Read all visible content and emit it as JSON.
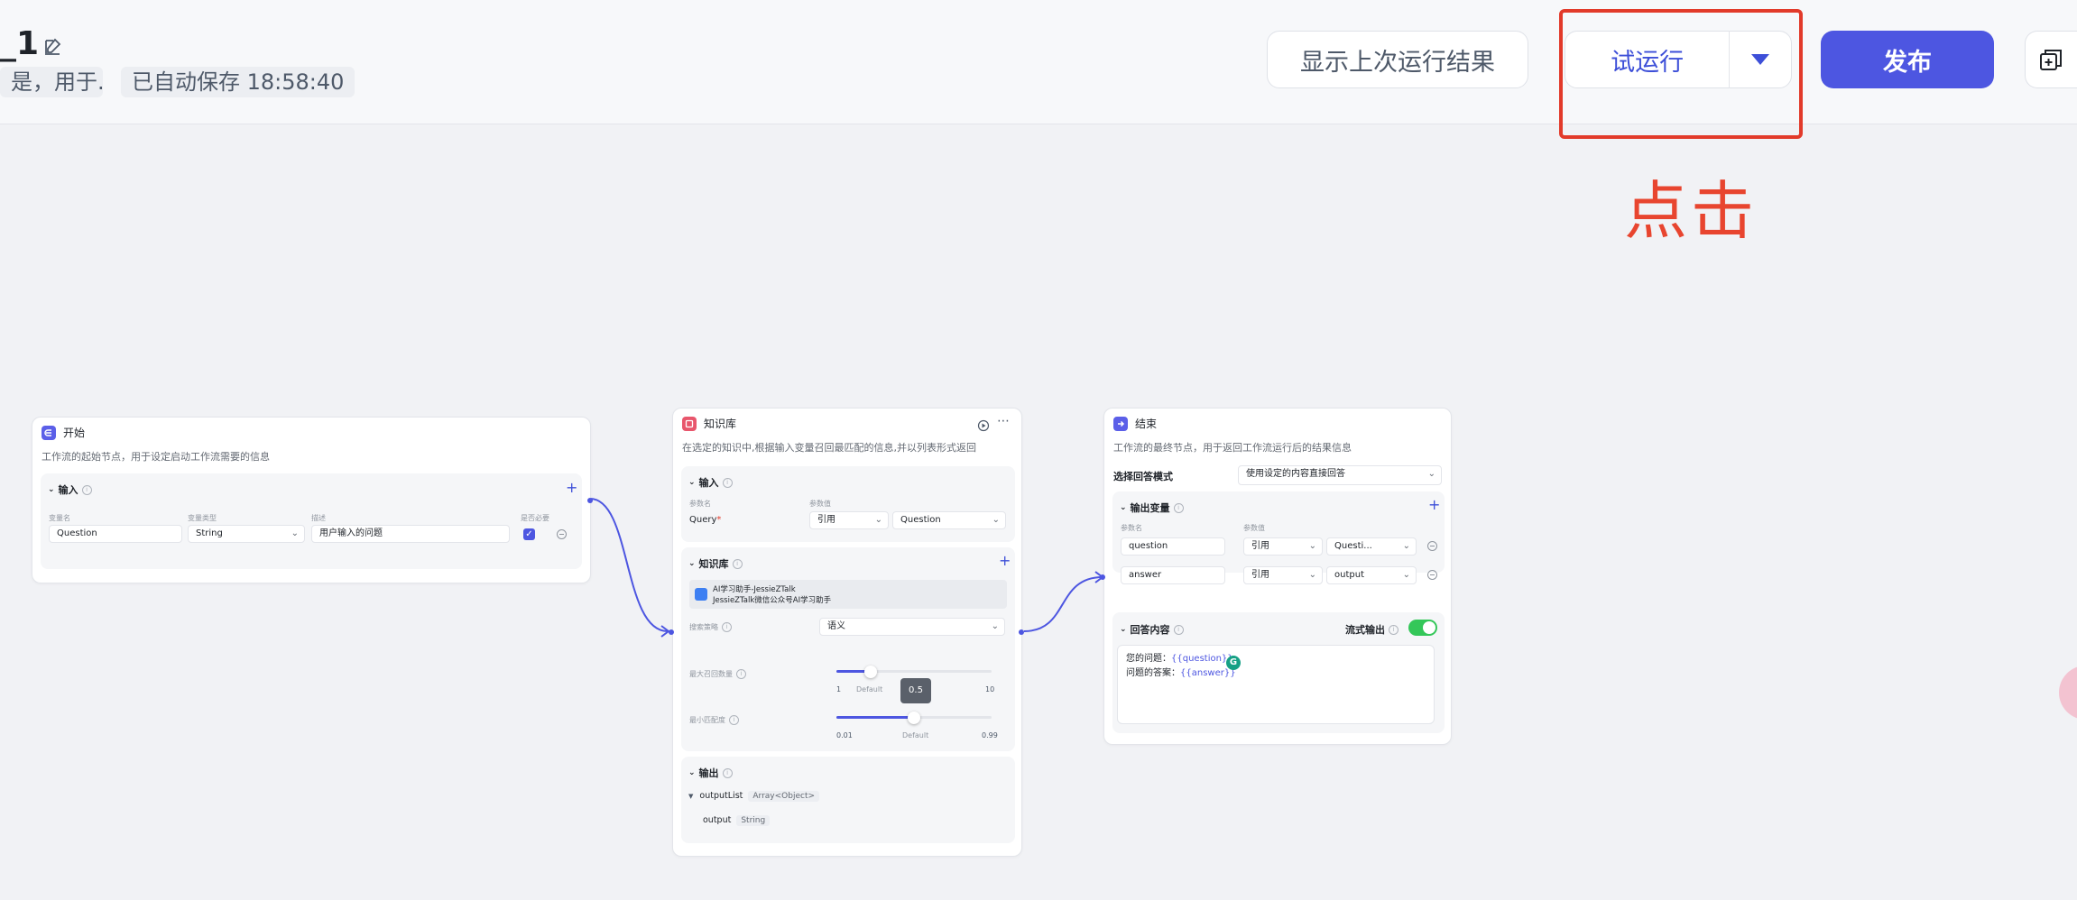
{
  "header": {
    "title": "_1",
    "description": "是，用于...",
    "save_status": "已自动保存 18:58:40",
    "show_last_run_label": "显示上次运行结果",
    "trial_run_label": "试运行",
    "publish_label": "发布",
    "annotation_text": "点击"
  },
  "start_node": {
    "title": "开始",
    "description": "工作流的起始节点，用于设定启动工作流需要的信息",
    "input_section": "输入",
    "col_name": "变量名",
    "col_type": "变量类型",
    "col_desc": "描述",
    "col_required": "是否必要",
    "var_name": "Question",
    "var_type": "String",
    "var_desc": "用户输入的问题"
  },
  "kb_node": {
    "title": "知识库",
    "description": "在选定的知识中,根据输入变量召回最匹配的信息,并以列表形式返回",
    "input_section": "输入",
    "col_param": "参数名",
    "col_value": "参数值",
    "query_label": "Query",
    "ref_label": "引用",
    "query_value": "Question",
    "kb_section": "知识库",
    "kb_item_line1": "AI学习助手-JessieZTalk",
    "kb_item_line2": "JessieZTalk微信公众号AI学习助手",
    "search_strategy_label": "搜索策略",
    "search_strategy_value": "语义",
    "max_recall_label": "最大召回数量",
    "max_recall_min": "1",
    "max_recall_default": "Default",
    "max_recall_max": "10",
    "max_recall_value": 3,
    "min_match_label": "最小匹配度",
    "min_match_min": "0.01",
    "min_match_default": "Default",
    "min_match_max": "0.99",
    "min_match_value": "0.5",
    "output_section": "输出",
    "output_list": "outputList",
    "output_list_type": "Array<Object>",
    "output_item": "output",
    "output_item_type": "String"
  },
  "end_node": {
    "title": "结束",
    "description": "工作流的最终节点，用于返回工作流运行后的结果信息",
    "mode_label": "选择回答模式",
    "mode_value": "使用设定的内容直接回答",
    "output_section": "输出变量",
    "col_param": "参数名",
    "col_value": "参数值",
    "rows": [
      {
        "name": "question",
        "ref": "引用",
        "value": "Questi..."
      },
      {
        "name": "answer",
        "ref": "引用",
        "value": "output"
      }
    ],
    "answer_section": "回答内容",
    "stream_label": "流式输出",
    "answer_line1_prefix": "您的问题：",
    "answer_line1_var": "{{question}}",
    "answer_line2_prefix": "问题的答案：",
    "answer_line2_var": "{{answer}}"
  },
  "colors": {
    "accent": "#4d56e1",
    "annotation_red": "#e23a2a",
    "toggle_on": "#34c759"
  }
}
